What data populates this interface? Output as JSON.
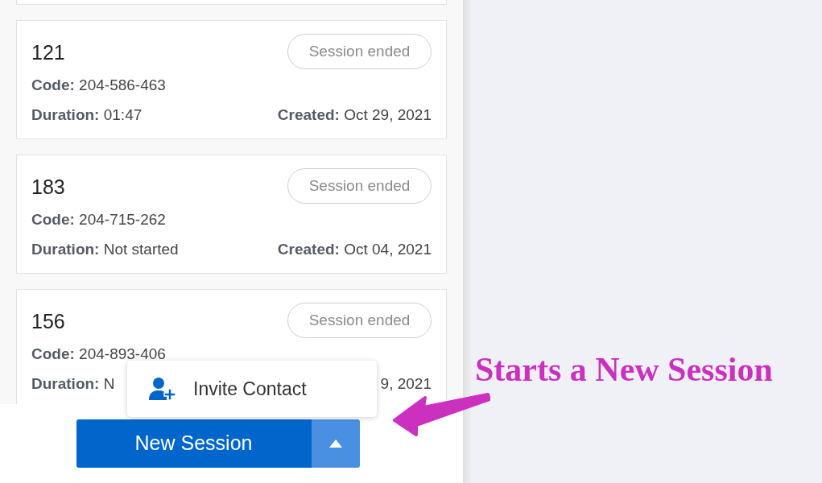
{
  "sessions": [
    {
      "number": "121",
      "status": "Session ended",
      "code": {
        "label": "Code:",
        "value": "204-586-463"
      },
      "duration": {
        "label": "Duration:",
        "value": "01:47"
      },
      "created": {
        "label": "Created:",
        "value": "Oct 29, 2021"
      }
    },
    {
      "number": "183",
      "status": "Session ended",
      "code": {
        "label": "Code:",
        "value": "204-715-262"
      },
      "duration": {
        "label": "Duration:",
        "value": "Not started"
      },
      "created": {
        "label": "Created:",
        "value": "Oct 04, 2021"
      }
    },
    {
      "number": "156",
      "status": "Session ended",
      "code": {
        "label": "Code:",
        "value": "204-893-406"
      },
      "duration": {
        "label": "Duration:",
        "value": "N"
      },
      "created": {
        "value": "9, 2021"
      }
    }
  ],
  "menu": {
    "items": [
      {
        "label": "Invite Contact"
      }
    ]
  },
  "new_session_button": {
    "label": "New Session",
    "menu_open": true
  },
  "annotation": {
    "text": "Starts a New Session"
  }
}
